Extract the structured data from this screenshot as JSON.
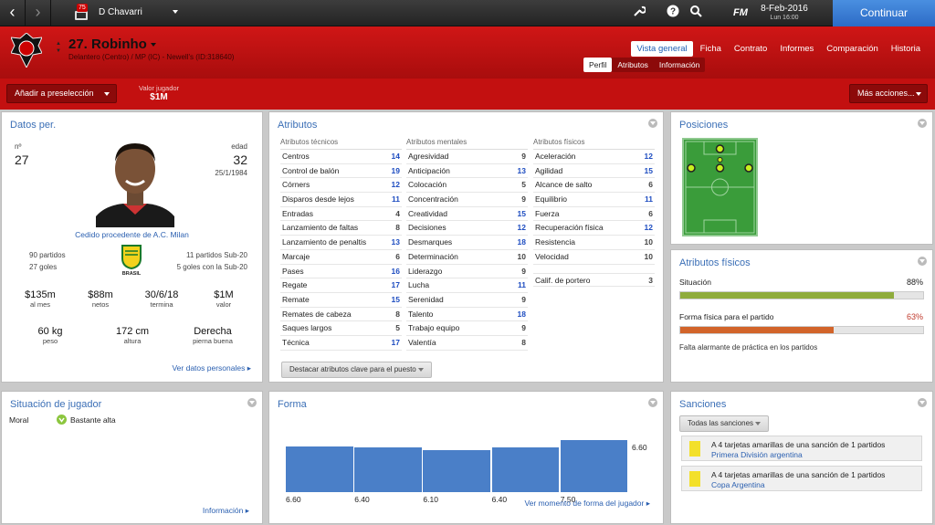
{
  "topbar": {
    "manager_name": "D Chavarri",
    "inbox_count": "75",
    "game_logo": "FM",
    "date": "8-Feb-2016",
    "day": "Lun 16:00",
    "continue_label": "Continuar"
  },
  "header": {
    "player_name": "27. Robinho",
    "subtitle": "Delantero (Centro) / MP (IC) - Newell's (ID:318640)",
    "crest_text": "N.O.B",
    "tabs": [
      "Vista general",
      "Ficha",
      "Contrato",
      "Informes",
      "Comparación",
      "Historia"
    ],
    "subtabs": [
      "Perfil",
      "Atributos",
      "Información"
    ]
  },
  "actions": {
    "shortlist": "Añadir a preselección",
    "value_label": "Valor jugador",
    "value": "$1M",
    "more": "Más acciones..."
  },
  "personal": {
    "title": "Datos per.",
    "number_label": "nº",
    "number": "27",
    "age_label": "edad",
    "age": "32",
    "dob": "25/1/1984",
    "loan": "Cedido procedente de A.C. Milan",
    "left_stats": [
      "90 partidos",
      "27 goles"
    ],
    "right_stats": [
      "11 partidos Sub-20",
      "5 goles con la Sub-20"
    ],
    "nation": "BRASIL",
    "money": [
      {
        "value": "$135m",
        "label": "al mes"
      },
      {
        "value": "$88m",
        "label": "netos"
      },
      {
        "value": "30/6/18",
        "label": "termina"
      },
      {
        "value": "$1M",
        "label": "valor"
      }
    ],
    "body": [
      {
        "value": "60 kg",
        "label": "peso"
      },
      {
        "value": "172 cm",
        "label": "altura"
      },
      {
        "value": "Derecha",
        "label": "pierna buena"
      }
    ],
    "link": "Ver datos personales"
  },
  "attributes": {
    "title": "Atributos",
    "technical_title": "Atributos técnicos",
    "mental_title": "Atributos mentales",
    "physical_title": "Atributos físicos",
    "technical": [
      {
        "name": "Centros",
        "value": "14",
        "hi": true
      },
      {
        "name": "Control de balón",
        "value": "19",
        "hi": true
      },
      {
        "name": "Córners",
        "value": "12",
        "hi": true
      },
      {
        "name": "Disparos desde lejos",
        "value": "11",
        "hi": true
      },
      {
        "name": "Entradas",
        "value": "4",
        "hi": false
      },
      {
        "name": "Lanzamiento de faltas",
        "value": "8",
        "hi": false
      },
      {
        "name": "Lanzamiento de penaltis",
        "value": "13",
        "hi": true
      },
      {
        "name": "Marcaje",
        "value": "6",
        "hi": false
      },
      {
        "name": "Pases",
        "value": "16",
        "hi": true
      },
      {
        "name": "Regate",
        "value": "17",
        "hi": true
      },
      {
        "name": "Remate",
        "value": "15",
        "hi": true
      },
      {
        "name": "Remates de cabeza",
        "value": "8",
        "hi": false
      },
      {
        "name": "Saques largos",
        "value": "5",
        "hi": false
      },
      {
        "name": "Técnica",
        "value": "17",
        "hi": true
      }
    ],
    "mental": [
      {
        "name": "Agresividad",
        "value": "9",
        "hi": false
      },
      {
        "name": "Anticipación",
        "value": "13",
        "hi": true
      },
      {
        "name": "Colocación",
        "value": "5",
        "hi": false
      },
      {
        "name": "Concentración",
        "value": "9",
        "hi": false
      },
      {
        "name": "Creatividad",
        "value": "15",
        "hi": true
      },
      {
        "name": "Decisiones",
        "value": "12",
        "hi": true
      },
      {
        "name": "Desmarques",
        "value": "18",
        "hi": true
      },
      {
        "name": "Determinación",
        "value": "10",
        "hi": false
      },
      {
        "name": "Liderazgo",
        "value": "9",
        "hi": false
      },
      {
        "name": "Lucha",
        "value": "11",
        "hi": true
      },
      {
        "name": "Serenidad",
        "value": "9",
        "hi": false
      },
      {
        "name": "Talento",
        "value": "18",
        "hi": true
      },
      {
        "name": "Trabajo equipo",
        "value": "9",
        "hi": false
      },
      {
        "name": "Valentía",
        "value": "8",
        "hi": false
      }
    ],
    "physical": [
      {
        "name": "Aceleración",
        "value": "12",
        "hi": true
      },
      {
        "name": "Agilidad",
        "value": "15",
        "hi": true
      },
      {
        "name": "Alcance de salto",
        "value": "6",
        "hi": false
      },
      {
        "name": "Equilibrio",
        "value": "11",
        "hi": true
      },
      {
        "name": "Fuerza",
        "value": "6",
        "hi": false
      },
      {
        "name": "Recuperación física",
        "value": "12",
        "hi": true
      },
      {
        "name": "Resistencia",
        "value": "10",
        "hi": false
      },
      {
        "name": "Velocidad",
        "value": "10",
        "hi": false
      }
    ],
    "gk": {
      "name": "Calif. de portero",
      "value": "3"
    },
    "highlight_button": "Destacar atributos clave para el puesto"
  },
  "positions": {
    "title": "Posiciones"
  },
  "physical_attrs": {
    "title": "Atributos físicos",
    "situation_label": "Situación",
    "situation_value": "88%",
    "situation_level": 0.88,
    "fitness_label": "Forma física para el partido",
    "fitness_value": "63%",
    "fitness_level": 0.63,
    "note": "Falta alarmante de práctica en los partidos",
    "colors": {
      "situation": "#8fac3c",
      "fitness": "#d2642a"
    }
  },
  "situation": {
    "title": "Situación de jugador",
    "morale_label": "Moral",
    "morale_value": "Bastante alta",
    "link": "Información"
  },
  "form": {
    "title": "Forma",
    "link": "Ver momento de forma del jugador",
    "average": "6.60"
  },
  "chart_data": {
    "type": "bar",
    "categories": [
      "6.60",
      "6.40",
      "6.10",
      "6.40",
      "7.50"
    ],
    "values": [
      6.6,
      6.4,
      6.1,
      6.4,
      7.5
    ],
    "average": 6.6,
    "ylim": [
      0,
      8.4
    ]
  },
  "sanctions": {
    "title": "Sanciones",
    "filter": "Todas las sanciones",
    "items": [
      {
        "text": "A 4 tarjetas amarillas de una sanción de 1 partidos",
        "competition": "Primera División argentina"
      },
      {
        "text": "A 4 tarjetas amarillas de una sanción de 1 partidos",
        "competition": "Copa Argentina"
      }
    ]
  }
}
